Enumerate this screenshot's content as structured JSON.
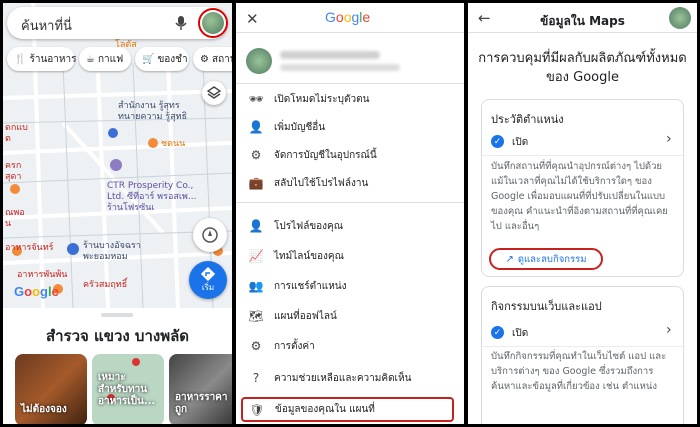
{
  "left": {
    "search_placeholder": "ค้นหาที่นี่",
    "chips": [
      "ร้านอาหาร",
      "กาแฟ",
      "ของชำ",
      "สถาน"
    ],
    "map_labels": {
      "top": "โลตัส",
      "office": "สำนักงาน รู้สุทร\nทนายความ รู้สุทธิ",
      "chodenn": "ชดนน",
      "company": "CTR Prosperity Co.,\nLtd. ซีทีอาร์ พรอสเพ...\nร้านโฟรซันเ",
      "left_a": "ครก\nสุดา",
      "left_b": "ณพอ\nน",
      "shop": "ร้านบางอัจฉรา\nพะยอมหอม",
      "chanth": "อาหารจันทร์",
      "phanphon": "อาหารพันพ้น",
      "krua": "ครัวสมฤทธิ์",
      "left_c": "ดกแบ\nต"
    },
    "google_logo": "Google",
    "go_label": "เริ่ม",
    "sheet_title": "สำรวจ แขวง บางพลัด",
    "cards": [
      "ไม่ต้องจอง",
      "เหมาะ\nสำหรับทาน\nอาหารเป็น...",
      "อาหารราคา\nถูก"
    ]
  },
  "middle": {
    "logo_letters": [
      "G",
      "o",
      "o",
      "g",
      "l",
      "e"
    ],
    "logo_colors": [
      "#4285f4",
      "#ea4335",
      "#fbbc05",
      "#4285f4",
      "#34a853",
      "#ea4335"
    ],
    "menu": [
      {
        "icon": "incognito-icon",
        "label": "เปิดโหมดไม่ระบุตัวตน"
      },
      {
        "icon": "add-account-icon",
        "label": "เพิ่มบัญชีอื่น"
      },
      {
        "icon": "manage-accounts-icon",
        "label": "จัดการบัญชีในอุปกรณ์นี้"
      },
      {
        "icon": "switch-profile-icon",
        "label": "สลับไปใช้โปรไฟล์งาน"
      },
      {
        "icon": "profile-icon",
        "label": "โปรไฟล์ของคุณ"
      },
      {
        "icon": "timeline-icon",
        "label": "ไทม์ไลน์ของคุณ"
      },
      {
        "icon": "location-sharing-icon",
        "label": "การแชร์ตำแหน่ง"
      },
      {
        "icon": "offline-maps-icon",
        "label": "แผนที่ออฟไลน์"
      },
      {
        "icon": "settings-icon",
        "label": "การตั้งค่า"
      },
      {
        "icon": "help-icon",
        "label": "ความช่วยเหลือและความคิดเห็น"
      },
      {
        "icon": "data-shield-icon",
        "label": "ข้อมูลของคุณใน แผนที่"
      }
    ]
  },
  "right": {
    "title": "ข้อมูลใน Maps",
    "heading": "การควบคุมที่มีผลกับผลิตภัณฑ์ทั้งหมดของ Google",
    "location_history": {
      "title": "ประวัติตำแหน่ง",
      "status": "เปิด",
      "desc": "บันทึกสถานที่ที่คุณนำอุปกรณ์ต่างๆ ไปด้วย แม้ในเวลาที่คุณไม่ได้ใช้บริการใดๆ ของ Google เพื่อมอบแผนที่ที่ปรับเปลี่ยนในแบบของคุณ คำแนะนำที่อิงตามสถานที่ที่คุณเคยไป และอื่นๆ",
      "button": "ดูและลบกิจกรรม"
    },
    "web_activity": {
      "title": "กิจกรรมบนเว็บและแอป",
      "status": "เปิด",
      "desc": "บันทึกกิจกรรมที่คุณทำในเว็บไซต์ แอป และบริการต่างๆ ของ Google ซึ่งรวมถึงการค้นหาและข้อมูลที่เกี่ยวข้อง เช่น ตำแหน่ง"
    }
  }
}
